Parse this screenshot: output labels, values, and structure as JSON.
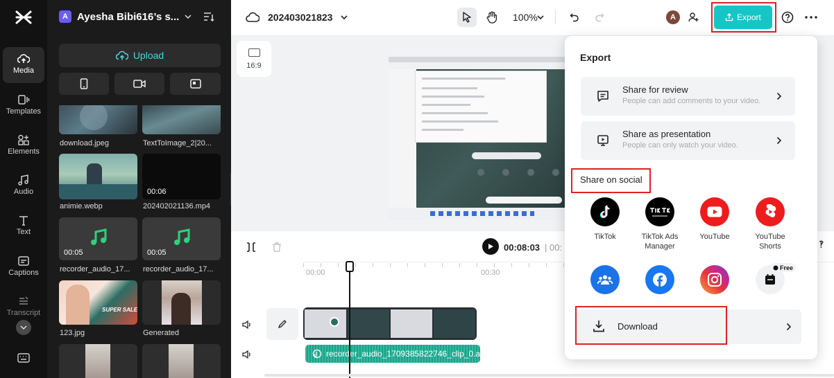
{
  "rail": {
    "items": [
      {
        "label": "Media"
      },
      {
        "label": "Templates"
      },
      {
        "label": "Elements"
      },
      {
        "label": "Audio"
      },
      {
        "label": "Text"
      },
      {
        "label": "Captions"
      },
      {
        "label": "Transcript"
      }
    ]
  },
  "panel": {
    "workspace": "Ayesha Bibi616’s s...",
    "workspace_initial": "A",
    "upload_label": "Upload",
    "media": [
      {
        "caption": "download.jpeg"
      },
      {
        "caption": "TextToImage_2|20..."
      },
      {
        "caption": "animie.webp"
      },
      {
        "caption": "202402021136.mp4",
        "duration": "00:06"
      },
      {
        "caption": "recorder_audio_17...",
        "duration": "00:05"
      },
      {
        "caption": "recorder_audio_17...",
        "duration": "00:05"
      },
      {
        "caption": "123.jpg",
        "thumb_text": "SUPER SALE!"
      },
      {
        "caption": "Generated"
      }
    ]
  },
  "topbar": {
    "project_name": "202403021823",
    "zoom": "100%",
    "avatar_initial": "A",
    "export_label": "Export"
  },
  "canvas": {
    "ratio_label": "16:9"
  },
  "timeline": {
    "current_time": "00:08:03",
    "time_sep": "| 00:",
    "ticks": [
      "00:00",
      "00:30"
    ],
    "audio_clip_label": "recorder_audio_1709385822746_clip_0.a"
  },
  "export": {
    "title": "Export",
    "share_review": {
      "title": "Share for review",
      "desc": "People can add comments to your video."
    },
    "share_presentation": {
      "title": "Share as presentation",
      "desc": "People can only watch your video."
    },
    "social_heading": "Share on social",
    "social": [
      {
        "label": "TikTok"
      },
      {
        "label": "TikTok Ads Manager"
      },
      {
        "label": "YouTube"
      },
      {
        "label": "YouTube Shorts"
      }
    ],
    "free_badge": "Free",
    "download_label": "Download"
  },
  "colors": {
    "accent": "#16c6c6",
    "highlight_red": "#e02020",
    "youtube_red": "#ee1c1c",
    "facebook_blue": "#1877f2",
    "teal_audio": "#13a58a"
  }
}
